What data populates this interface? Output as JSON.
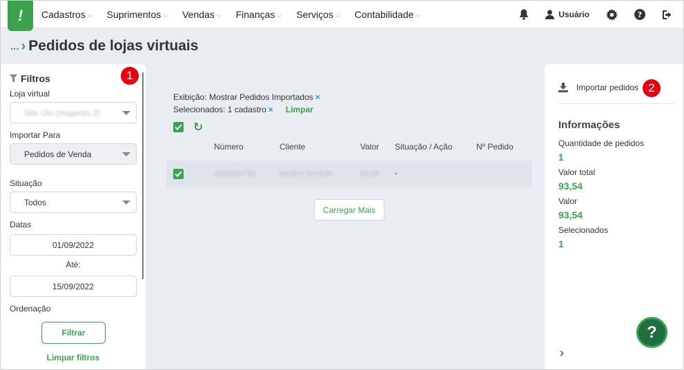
{
  "nav": {
    "logo": "!",
    "items": [
      {
        "label": "Cadastros",
        "caret": "⌵"
      },
      {
        "label": "Suprimentos",
        "caret": "⌵"
      },
      {
        "label": "Vendas",
        "caret": "⌵"
      },
      {
        "label": "Finanças",
        "caret": "⌵"
      },
      {
        "label": "Serviços",
        "caret": "⌵"
      },
      {
        "label": "Contabilidade",
        "caret": "⌵"
      }
    ],
    "user_label": "Usuário",
    "icons": [
      "bell-icon",
      "user-icon",
      "gear-icon",
      "help-icon",
      "logout-icon"
    ]
  },
  "breadcrumb": {
    "dots": "...",
    "arrow": "›",
    "title": "Pedidos de lojas virtuais"
  },
  "filters": {
    "title": "Filtros",
    "loja_label": "Loja virtual",
    "loja_value": "Site Ulu (magento 2)",
    "importar_label": "Importar Para",
    "importar_value": "Pedidos de Venda",
    "situacao_label": "Situação",
    "situacao_value": "Todos",
    "datas_label": "Datas",
    "date_from": "01/09/2022",
    "ate_label": "Até:",
    "date_to": "15/09/2022",
    "ordenacao_label": "Ordenação",
    "filter_button": "Filtrar",
    "clear_link": "Limpar filtros"
  },
  "badges": {
    "one": "1",
    "two": "2"
  },
  "list": {
    "exibicao": "Exibição: Mostrar Pedidos Importados",
    "selecionados": "Selecionados: 1 cadastro",
    "clear_x": "×",
    "limpar": "Limpar",
    "columns": [
      "Número",
      "Cliente",
      "Valor",
      "Situação / Ação",
      "Nº Pedido"
    ],
    "row": {
      "numero": "1000016781",
      "cliente": "pauline ferrardo",
      "valor": "93,54",
      "situacao": "-",
      "pedido": ""
    },
    "load_more": "Carregar Mais"
  },
  "info": {
    "import_label": "Importar pedidos",
    "title": "Informações",
    "qtd_label": "Quantidade de pedidos",
    "qtd_value": "1",
    "total_label": "Valor total",
    "total_value": "93,54",
    "valor_label": "Valor",
    "valor_value": "93,54",
    "sel_label": "Selecionados",
    "sel_value": "1",
    "chevron": "›"
  },
  "help_fab": "?",
  "colors": {
    "accent": "#3aa34d",
    "badge": "#e8000f",
    "fab": "#1f6e3e"
  }
}
